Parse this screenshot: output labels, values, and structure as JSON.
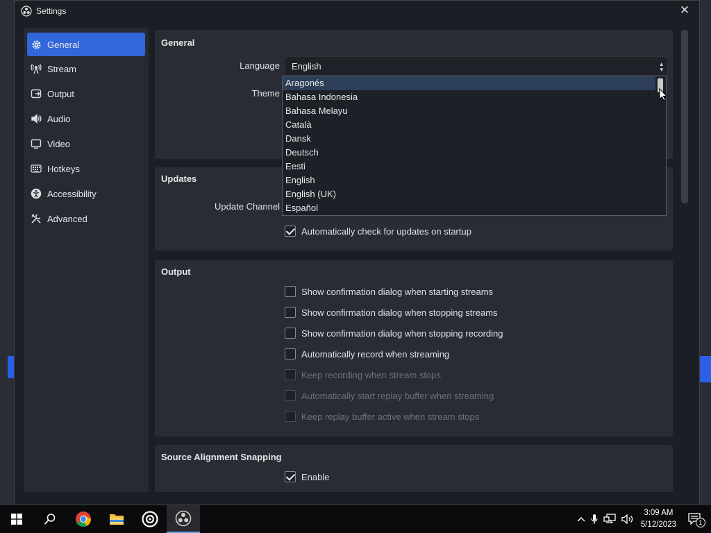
{
  "window": {
    "title": "Settings",
    "close_symbol": "✕"
  },
  "sidebar": {
    "items": [
      {
        "label": "General",
        "icon": "gear-icon",
        "active": true
      },
      {
        "label": "Stream",
        "icon": "antenna-icon"
      },
      {
        "label": "Output",
        "icon": "output-icon"
      },
      {
        "label": "Audio",
        "icon": "speaker-icon"
      },
      {
        "label": "Video",
        "icon": "monitor-icon"
      },
      {
        "label": "Hotkeys",
        "icon": "keyboard-icon"
      },
      {
        "label": "Accessibility",
        "icon": "accessibility-icon"
      },
      {
        "label": "Advanced",
        "icon": "wrench-icon"
      }
    ]
  },
  "general": {
    "heading": "General",
    "language_label": "Language",
    "language_value": "English",
    "theme_label": "Theme"
  },
  "language_dropdown": {
    "options": [
      "Aragonés",
      "Bahasa Indonesia",
      "Bahasa Melayu",
      "Català",
      "Dansk",
      "Deutsch",
      "Eesti",
      "English",
      "English (UK)",
      "Español"
    ],
    "highlighted": "Aragonés"
  },
  "updates": {
    "heading": "Updates",
    "channel_label": "Update Channel",
    "auto_check_label": "Automatically check for updates on startup",
    "auto_check": true
  },
  "output": {
    "heading": "Output",
    "options": [
      {
        "label": "Show confirmation dialog when starting streams",
        "checked": false,
        "disabled": false
      },
      {
        "label": "Show confirmation dialog when stopping streams",
        "checked": false,
        "disabled": false
      },
      {
        "label": "Show confirmation dialog when stopping recording",
        "checked": false,
        "disabled": false
      },
      {
        "label": "Automatically record when streaming",
        "checked": false,
        "disabled": false
      },
      {
        "label": "Keep recording when stream stops",
        "checked": false,
        "disabled": true
      },
      {
        "label": "Automatically start replay buffer when streaming",
        "checked": false,
        "disabled": true
      },
      {
        "label": "Keep replay buffer active when stream stops",
        "checked": false,
        "disabled": true
      }
    ]
  },
  "snapping": {
    "heading": "Source Alignment Snapping",
    "enable_label": "Enable",
    "enable": true
  },
  "taskbar": {
    "apps": [
      "windows-start-icon",
      "search-icon",
      "chrome-icon",
      "file-explorer-icon",
      "obs-icon",
      "obs-icon"
    ],
    "time": "3:09 AM",
    "date": "5/12/2023",
    "notification_count": "1"
  },
  "colors": {
    "accent": "#3167d8",
    "panel": "#292c35",
    "window": "#1c1e26"
  }
}
